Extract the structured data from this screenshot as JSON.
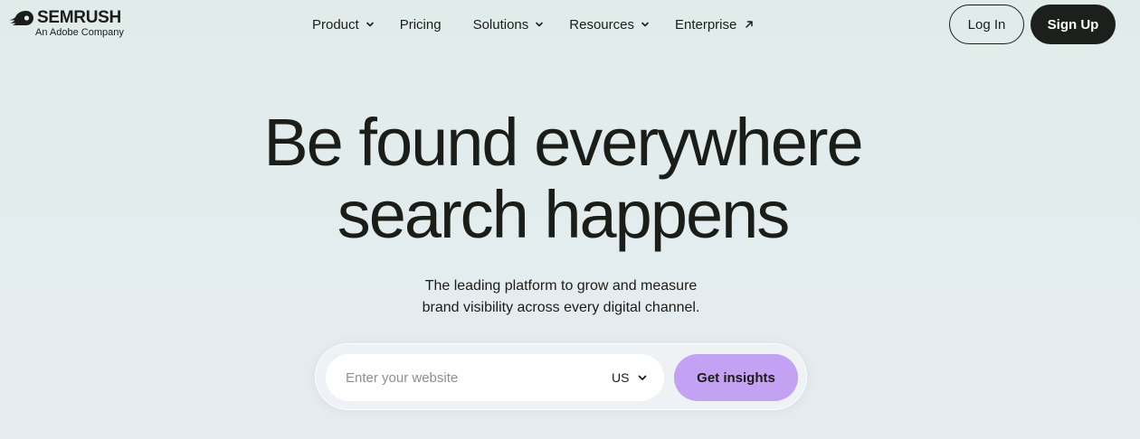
{
  "header": {
    "logo_text": "SEMRUSH",
    "logo_subtitle": "An Adobe Company",
    "nav": [
      {
        "label": "Product",
        "icon": "chevron-down-icon"
      },
      {
        "label": "Pricing"
      },
      {
        "label": "Solutions",
        "icon": "chevron-down-icon"
      },
      {
        "label": "Resources",
        "icon": "chevron-down-icon"
      },
      {
        "label": "Enterprise",
        "icon": "arrow-up-right-icon"
      }
    ],
    "login_label": "Log In",
    "signup_label": "Sign Up"
  },
  "hero": {
    "title_line1": "Be found everywhere",
    "title_line2": "search happens",
    "subtitle_line1": "The leading platform to grow and measure",
    "subtitle_line2": "brand visibility across every digital channel."
  },
  "search": {
    "value": "",
    "placeholder": "Enter your website",
    "country": "US",
    "submit_label": "Get insights"
  },
  "colors": {
    "brand_dark": "#1c1f1b",
    "accent_purple": "#c3a1f3",
    "background": "#e1ecea"
  }
}
